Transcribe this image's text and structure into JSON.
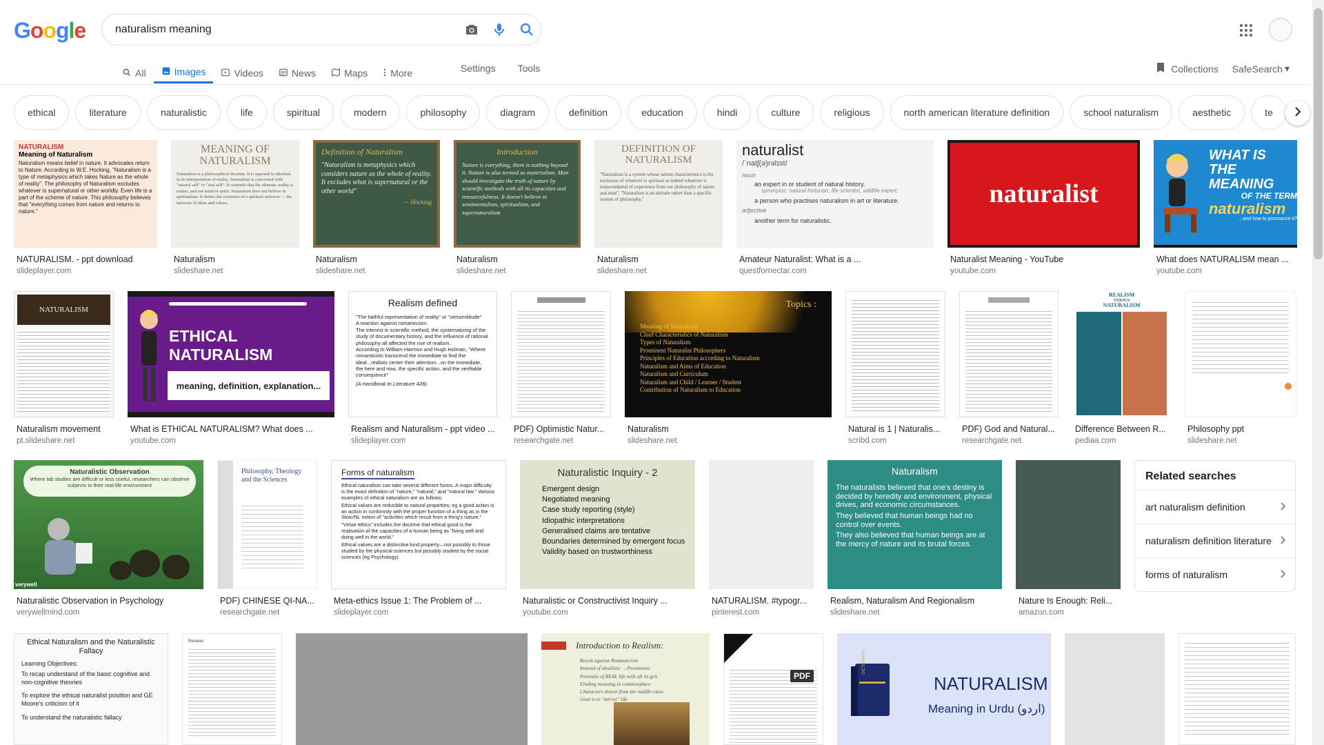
{
  "logo": {
    "letters": [
      "G",
      "o",
      "o",
      "g",
      "l",
      "e"
    ]
  },
  "search": {
    "query": "naturalism meaning"
  },
  "tabs": [
    {
      "label": "All"
    },
    {
      "label": "Images"
    },
    {
      "label": "Videos"
    },
    {
      "label": "News"
    },
    {
      "label": "Maps"
    },
    {
      "label": "More"
    }
  ],
  "tools": {
    "settings": "Settings",
    "tools": "Tools"
  },
  "header_right": {
    "collections": "Collections",
    "safesearch": "SafeSearch"
  },
  "chips": [
    "ethical",
    "literature",
    "naturalistic",
    "life",
    "spiritual",
    "modern",
    "philosophy",
    "diagram",
    "definition",
    "education",
    "hindi",
    "culture",
    "religious",
    "north american literature definition",
    "school naturalism",
    "aesthetic",
    "te"
  ],
  "row1": [
    {
      "caption": "NATURALISM. - ppt download",
      "source": "slideplayer.com",
      "t1": "NATURALISM",
      "t2": "Meaning of Naturalism",
      "t3": "Naturalism means belief in nature. It advocates return to Nature. According to W.E. Hocking, \"Naturalism is a type of metaphysics which takes Nature as the whole of reality\". The philosophy of Naturalism excludes whatever is supernatural or other worldly. Even life is a part of the scheme of nature. This philosophy believes that \"everything comes from nature and returns to nature.\""
    },
    {
      "caption": "Naturalism",
      "source": "slideshare.net",
      "t1": "MEANING OF NATURALISM",
      "t3": "Naturalism is a philosophical doctrine. It is opposed to idealism in its interpretation of reality. Naturalism is concerned with \"natural self\" or \"real self\". It contends that the ultimate reality is matter, and not mind or spirit. Naturalism does not believe in spiritualism. It denies the existence of a spiritual universe — the universe of ideas and values."
    },
    {
      "caption": "Naturalism",
      "source": "slideshare.net",
      "t1": "Definition of Naturalism",
      "t3": "\"Naturalism is metaphysics which considers nature as the whole of reality. It excludes what is supernatural or the other world\"",
      "t4": "— Hocking"
    },
    {
      "caption": "Naturalism",
      "source": "slideshare.net",
      "t1": "Introduction",
      "t3": "Nature is everything, there is nothing beyond it. Nature is also termed as materialism. Man should investigate the truth of nature by scientific methods with all its capacities and resourcefulness. It doesn't believe in sentimentalism, spiritualism, and supernaturalism"
    },
    {
      "caption": "Naturalism",
      "source": "slideshare.net",
      "t1": "DEFINITION OF NATURALISM",
      "t3": "\"Naturalism is a system whose salient characteristics is the exclusion of whatever is spiritual or indeed whatever is transcendental of experience from our philosophy of nature and man\". \"Naturalism is an attitude rather than a specific system of philosophy.\""
    },
    {
      "caption": "Amateur Naturalist: What is a ...",
      "source": "questfornectar.com",
      "t1": "naturalist",
      "t2": "/ˈnatʃ(ə)rəlɪst/",
      "t3": "noun",
      "t4": "an expert in or student of natural history.",
      "t5": "synonyms: natural historian, life scientist, wildlife expert;",
      "t6": "a person who practises naturalism in art or literature.",
      "t7": "adjective",
      "t8": "another term for naturalistic."
    },
    {
      "caption": "Naturalist Meaning - YouTube",
      "source": "youtube.com",
      "t1": "naturalist"
    },
    {
      "caption": "What does NATURALISM mean ...",
      "source": "youtube.com",
      "t1": "WHAT IS",
      "t2": "THE MEANING",
      "t3": "OF THE TERM",
      "t4": "naturalism",
      "t5": "...and how to pronounce it?"
    }
  ],
  "row2": [
    {
      "caption": "Naturalism movement",
      "source": "pt.slideshare.net",
      "t1": "NATURALISM"
    },
    {
      "caption": "What is ETHICAL NATURALISM? What does ...",
      "source": "youtube.com",
      "t1": "ETHICAL NATURALISM",
      "t2": "meaning, definition, explanation..."
    },
    {
      "caption": "Realism and Naturalism - ppt video ...",
      "source": "slideplayer.com",
      "t1": "Realism defined",
      "b1": "\"The faithful representation of reality\" or \"verisimilitude\"",
      "b2": "A reaction against romanticism.",
      "b3": "The interest in scientific method, the systematizing of the study of documentary history, and the influence of rational philosophy all affected the rise of realism.",
      "b4": "According to William Harmon and Hugh Holman, \"Where romanticists transcend the immediate to find the ideal...realists center their attention...on the immediate, the here and now, the specific action, and the verifiable consequence\"",
      "b5": "(A Handbook to Literature 428)."
    },
    {
      "caption": "PDF) Optimistic Natur...",
      "source": "researchgate.net"
    },
    {
      "caption": "Naturalism",
      "source": "slideshare.net",
      "t1": "Topics :",
      "items": [
        "Meaning of Naturalism",
        "Chief Characteristics of Naturalism",
        "Types of Naturalism",
        "Prominent Naturalist Philosophers",
        "Principles of Education according to Naturalism",
        "Naturalism and Aims of Education",
        "Naturalism and Curriculum",
        "Naturalism and Child / Learner / Student",
        "Contribution of Naturalism to Education"
      ]
    },
    {
      "caption": "Natural is 1 | Naturalis...",
      "source": "scribd.com"
    },
    {
      "caption": "PDF) God and Natural...",
      "source": "researchgate.net"
    },
    {
      "caption": "Difference Between R...",
      "source": "pediaa.com",
      "t1": "REALISM",
      "t2": "VERSUS",
      "t3": "NATURALISM"
    },
    {
      "caption": "Philosophy ppt",
      "source": "slideshare.net"
    }
  ],
  "row3": [
    {
      "caption": "Naturalistic Observation in Psychology",
      "source": "verywellmind.com",
      "t1": "Naturalistic Observation",
      "t2": "Where lab studies are difficult or less useful, researchers can observe subjects in their real-life environment",
      "t3": "verywell"
    },
    {
      "caption": "PDF) CHINESE QI-NA...",
      "source": "researchgate.net",
      "t1": "Philosophy, Theology and the Sciences"
    },
    {
      "caption": "Meta-ethics Issue 1: The Problem of ...",
      "source": "slideplayer.com",
      "t1": "Forms of naturalism",
      "b1": "Ethical naturalism can take several different forms. A major difficulty is the exact definition of \"nature,\" \"natural,\" and \"natural law.\" Various examples of ethical naturalism are as follows:",
      "b2": "Ethical values are reducible to natural properties; eg a good action is an action in conformity with the proper function of a thing as in the Stoic/NL notion of \"activities which result from a thing's nature.\"",
      "b3": "\"Virtue ethics\" includes the doctrine that ethical good is the realisation of the capacities of a human being as \"living well and doing well in the world.\"",
      "b4": "Ethical values are a distinctive kind property—not possibly to those studied by the physical sciences but possibly studied by the social sciences (eg Psychology)."
    },
    {
      "caption": "Naturalistic or Constructivist Inquiry ...",
      "source": "youtube.com",
      "t1": "Naturalistic Inquiry - 2",
      "items": [
        "Emergent design",
        "Negotiated meaning",
        "Case study reporting (style)",
        "Idiopathic interpretations",
        "Generalised claims are tentative",
        "Boundaries determined by emergent focus",
        "Validity based on trustworthiness"
      ]
    },
    {
      "caption": "NATURALISM. #typogr...",
      "source": "pinterest.com"
    },
    {
      "caption": "Realism, Naturalism And Regionalism",
      "source": "slideshare.net",
      "t1": "Naturalism",
      "items": [
        "The naturalists believed that one's destiny is decided by heredity and environment, physical drives, and economic circumstances.",
        "They believed that human beings had no control over events.",
        "They also believed that human beings are at the mercy of nature and its brutal forces."
      ]
    },
    {
      "caption": "Nature Is Enough: Reli...",
      "source": "amazon.com"
    }
  ],
  "related": {
    "title": "Related searches",
    "items": [
      "art naturalism definition",
      "naturalism definition literature",
      "forms of naturalism"
    ]
  },
  "row4": [
    {
      "t1": "Ethical Naturalism and the Naturalistic Fallacy",
      "items": [
        "Learning Objectives:",
        "To recap understand of the basic cognitive and non-cognitive theories",
        "To explore the ethical naturalist position and GE Moore's criticism of it",
        "To understand the naturalistic fallacy"
      ]
    },
    {
      "t1": "Reviews"
    },
    {},
    {
      "t1": "Introduction to Realism:",
      "items": [
        "Revolt against Romanticism",
        "Instead of idealistic →Pessimistic",
        "Portraits of REAL life with all its grit",
        "Finding meaning in commonplace",
        "Characters drawn from the middle class",
        "Goal is to \"mirror\" life"
      ]
    },
    {
      "t1": "PDF"
    },
    {
      "t1": "NATURALISM",
      "t2": "Meaning in Urdu (اردو)",
      "t3": "DICTIONARY"
    },
    {},
    {}
  ],
  "colors": {
    "blue": "#4285F4",
    "red": "#EA4335",
    "yellow": "#FBBC05",
    "green": "#34A853",
    "accent": "#1a73e8"
  }
}
